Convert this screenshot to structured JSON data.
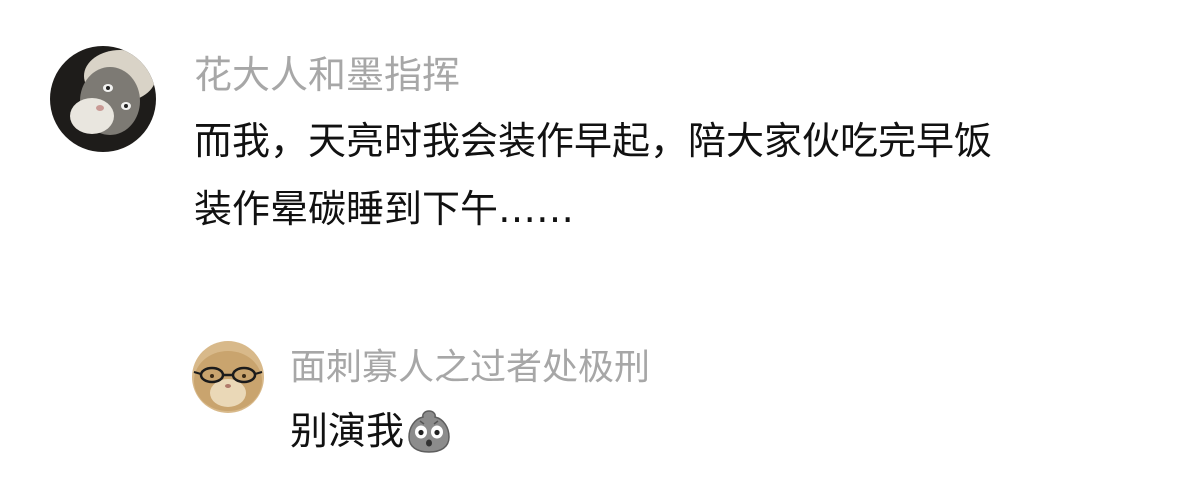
{
  "comments": [
    {
      "username": "花大人和墨指挥",
      "text_lines": [
        "而我，天亮时我会装作早起，陪大家伙吃完早饭",
        "装作晕碳睡到下午……"
      ]
    }
  ],
  "reply": {
    "username": "面刺寡人之过者处极刑",
    "text": "别演我",
    "emoji": "grimace-rock-emoji"
  },
  "colors": {
    "username": "#a7a7a7",
    "text": "#111111",
    "background": "#ffffff"
  }
}
